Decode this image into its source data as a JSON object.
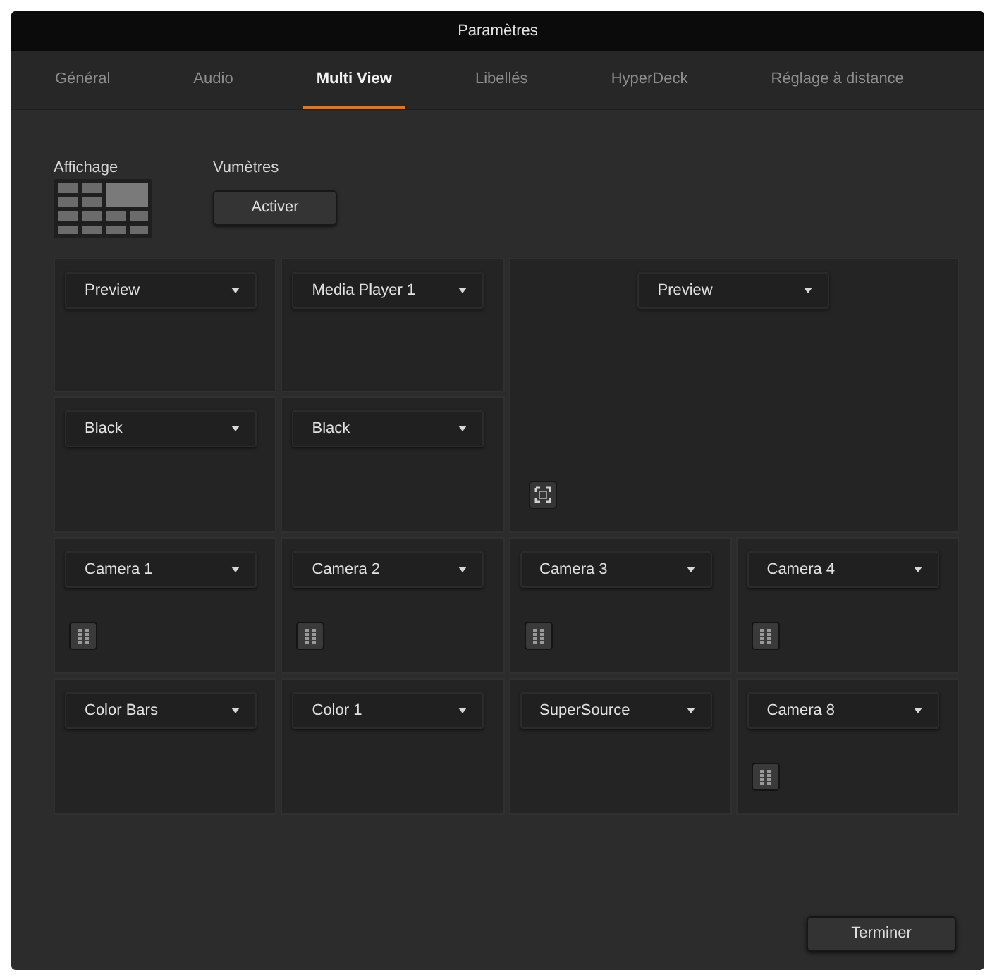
{
  "window": {
    "title": "Paramètres"
  },
  "tabs": [
    {
      "label": "Général",
      "selected": false
    },
    {
      "label": "Audio",
      "selected": false
    },
    {
      "label": "Multi View",
      "selected": true
    },
    {
      "label": "Libellés",
      "selected": false
    },
    {
      "label": "HyperDeck",
      "selected": false
    },
    {
      "label": "Réglage à distance",
      "selected": false
    }
  ],
  "layout": {
    "label": "Affichage"
  },
  "meters": {
    "label": "Vumètres",
    "button": "Activer"
  },
  "windows": [
    {
      "kind": "small",
      "source": "Preview",
      "vu_meter": false
    },
    {
      "kind": "small",
      "source": "Media Player 1",
      "vu_meter": false
    },
    {
      "kind": "large",
      "source": "Preview",
      "vu_meter": false
    },
    {
      "kind": "small",
      "source": "Black",
      "vu_meter": false
    },
    {
      "kind": "small",
      "source": "Black",
      "vu_meter": false
    },
    {
      "kind": "small",
      "source": "Camera 1",
      "vu_meter": true
    },
    {
      "kind": "small",
      "source": "Camera 2",
      "vu_meter": true
    },
    {
      "kind": "small",
      "source": "Camera 3",
      "vu_meter": true
    },
    {
      "kind": "small",
      "source": "Camera 4",
      "vu_meter": true
    },
    {
      "kind": "small",
      "source": "Color Bars",
      "vu_meter": false
    },
    {
      "kind": "small",
      "source": "Color 1",
      "vu_meter": false
    },
    {
      "kind": "small",
      "source": "SuperSource",
      "vu_meter": false
    },
    {
      "kind": "small",
      "source": "Camera 8",
      "vu_meter": true
    }
  ],
  "footer": {
    "button": "Terminer"
  }
}
